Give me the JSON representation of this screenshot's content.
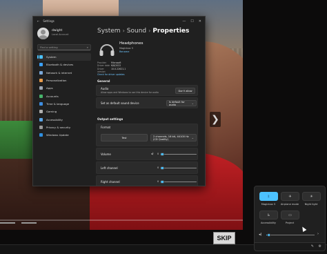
{
  "video": {
    "skip_label": "SKIP",
    "progress_fraction": 0
  },
  "settings": {
    "breadcrumb": {
      "root": "System",
      "middle": "Sound",
      "current": "Properties"
    },
    "window_title": "Settings",
    "user": {
      "name": "dwight",
      "sub": "Local Account"
    },
    "search": {
      "placeholder": "Find a setting"
    },
    "nav": [
      {
        "label": "System",
        "color": "#4cc2ff",
        "active": true
      },
      {
        "label": "Bluetooth & devices",
        "color": "#3aa0ff",
        "active": false
      },
      {
        "label": "Network & internet",
        "color": "#7aa7d8",
        "active": false
      },
      {
        "label": "Personalization",
        "color": "#e79b4b",
        "active": false
      },
      {
        "label": "Apps",
        "color": "#9ea7b4",
        "active": false
      },
      {
        "label": "Accounts",
        "color": "#47b36b",
        "active": false
      },
      {
        "label": "Time & language",
        "color": "#3d8de0",
        "active": false
      },
      {
        "label": "Gaming",
        "color": "#b0b0b0",
        "active": false
      },
      {
        "label": "Accessibility",
        "color": "#5aa6e8",
        "active": false
      },
      {
        "label": "Privacy & security",
        "color": "#9a9a9a",
        "active": false
      },
      {
        "label": "Windows Update",
        "color": "#2f8fe0",
        "active": false
      }
    ],
    "device": {
      "name": "Headphones",
      "sub": "Magicbox 5",
      "rename": "Rename",
      "props": [
        {
          "key": "Provider",
          "value": "Microsoft"
        },
        {
          "key": "Driver date",
          "value": "6/8/2022"
        },
        {
          "key": "Driver version",
          "value": "10.0.22621.1"
        }
      ],
      "check_link": "Check for driver updates"
    },
    "general": {
      "section": "General",
      "audio_title": "Audio",
      "audio_sub": "Allow apps and Windows to use this device for audio",
      "audio_button": "Don't allow",
      "default_label": "Set as default sound device",
      "default_value": "Is default for audio"
    },
    "output": {
      "section": "Output settings",
      "format_label": "Format",
      "test_button": "Test",
      "format_value": "2 channels, 16 bit, 44100 Hz (CD Quality)",
      "volume_label": "Volume",
      "volume_value": "0",
      "left_label": "Left channel",
      "left_value": "0",
      "right_label": "Right channel",
      "right_value": "0"
    }
  },
  "quick_settings": {
    "tiles": [
      {
        "label": "Magicbox 5",
        "icon": "bluetooth-icon",
        "on": true
      },
      {
        "label": "Airplane mode",
        "icon": "airplane-icon",
        "on": false
      },
      {
        "label": "Night light",
        "icon": "night-light-icon",
        "on": false
      },
      {
        "label": "Accessibility",
        "icon": "accessibility-icon",
        "on": false
      },
      {
        "label": "Project",
        "icon": "project-icon",
        "on": false
      }
    ],
    "volume_fraction": 0.05
  }
}
